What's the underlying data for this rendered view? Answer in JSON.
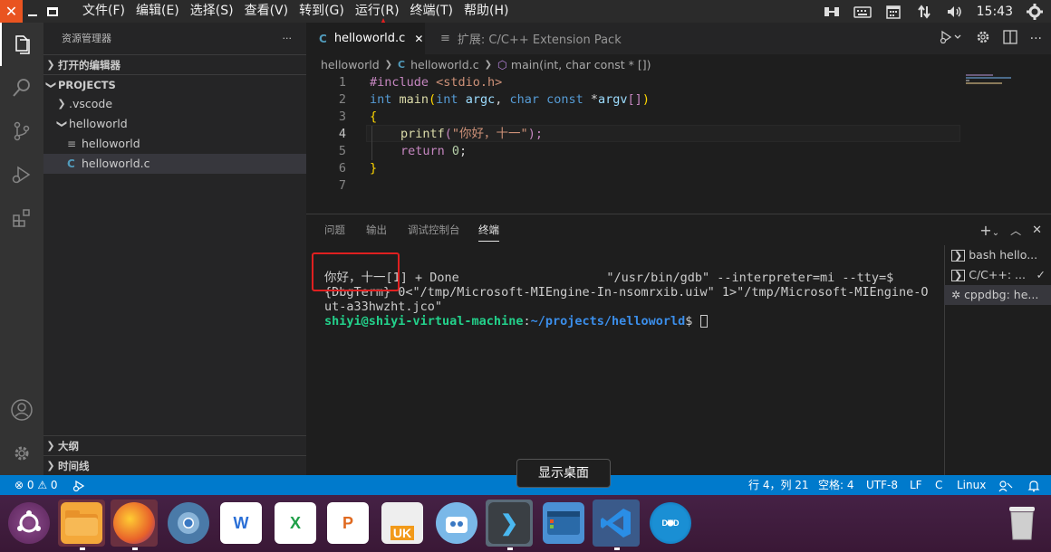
{
  "topbar": {
    "close_symbol": "✕",
    "menus": [
      "文件(F)",
      "编辑(E)",
      "选择(S)",
      "查看(V)",
      "转到(G)",
      "运行(R)",
      "终端(T)",
      "帮助(H)"
    ],
    "time": "15:43",
    "tray_icons": [
      "window-switch-icon",
      "keyboard-icon",
      "calendar-icon",
      "network-icon",
      "volume-icon",
      "power-icon"
    ]
  },
  "activity_icons": [
    "explorer-icon",
    "search-icon",
    "source-control-icon",
    "run-debug-icon",
    "extensions-icon",
    "account-icon",
    "settings-gear-icon"
  ],
  "sidebar": {
    "title": "资源管理器",
    "more": "···",
    "open_editors": "打开的编辑器",
    "projects": "PROJECTS",
    "tree": [
      {
        "label": ".vscode",
        "type": "folder-collapsed"
      },
      {
        "label": "helloworld",
        "type": "folder-open"
      },
      {
        "label": "helloworld",
        "type": "file"
      },
      {
        "label": "helloworld.c",
        "type": "c-file"
      }
    ],
    "outline": "大纲",
    "timeline": "时间线"
  },
  "tabs": [
    {
      "label": "helloworld.c",
      "icon": "C",
      "active": true
    },
    {
      "label": "扩展: C/C++ Extension Pack",
      "icon": "≡",
      "active": false
    }
  ],
  "breadcrumb": {
    "folder": "helloworld",
    "file": "helloworld.c",
    "symbol": "main(int, char const * [])"
  },
  "code": {
    "line_numbers": [
      "1",
      "2",
      "3",
      "4",
      "5",
      "6",
      "7"
    ],
    "l1_pp": "#include",
    "l1_hdr": " <stdio.h>",
    "l2_int": "int",
    "l2_main": " main",
    "l2_paren": "(",
    "l2_int2": "int",
    "l2_argc": " argc",
    "l2_comma": ", ",
    "l2_char": "char",
    "l2_const": " const",
    "l2_star": " *",
    "l2_argv": "argv",
    "l2_brk": "[]",
    "l2_close": ")",
    "l3": "{",
    "l4_fn": "printf",
    "l4_open": "(",
    "l4_str": "\"你好，十一\"",
    "l4_close": ");",
    "l5_ret": "return",
    "l5_num": " 0",
    "l5_semi": ";",
    "l6": "}"
  },
  "panel": {
    "tabs": [
      "问题",
      "输出",
      "调试控制台",
      "终端"
    ],
    "active_tab": "终端",
    "terminal_lines": [
      "你好，十一[1] + Done                    \"/usr/bin/gdb\" --interpreter=mi --tty=$",
      "{DbgTerm} 0<\"/tmp/Microsoft-MIEngine-In-nsomrxib.uiw\" 1>\"/tmp/Microsoft-MIEngine-O",
      "ut-a33hwzht.jco\""
    ],
    "prompt_user": "shiyi@shiyi-virtual-machine",
    "prompt_colon": ":",
    "prompt_path": "~/projects/helloworld",
    "prompt_dollar": "$ ",
    "sessions": [
      "bash hello...",
      "C/C++: ...",
      "cppdbg: he..."
    ]
  },
  "status": {
    "problems": "⊗ 0 ⚠ 0",
    "position": "行 4，列 21",
    "spaces": "空格: 4",
    "encoding": "UTF-8",
    "eol": "LF",
    "language": "C",
    "platform": "Linux"
  },
  "tooltip": "显示桌面",
  "dock": [
    {
      "name": "ubuntu-launcher-icon",
      "glyph": "◎",
      "color": "#6c2a64"
    },
    {
      "name": "files-icon",
      "glyph": "",
      "color": "#f0a030"
    },
    {
      "name": "firefox-icon",
      "glyph": "",
      "color": "#e8622a"
    },
    {
      "name": "chromium-icon",
      "glyph": "",
      "color": "#4a90c8"
    },
    {
      "name": "wps-writer-icon",
      "glyph": "W",
      "color": "#2a6fd6"
    },
    {
      "name": "wps-spreadsheet-icon",
      "glyph": "X",
      "color": "#1f9f48"
    },
    {
      "name": "wps-presentation-icon",
      "glyph": "P",
      "color": "#e06a20"
    },
    {
      "name": "ukylin-icon",
      "glyph": "UK",
      "color": "#e8e8e8"
    },
    {
      "name": "software-center-icon",
      "glyph": "",
      "color": "#5aa0d8"
    },
    {
      "name": "terminal-icon",
      "glyph": "❯",
      "color": "#444a50"
    },
    {
      "name": "show-desktop-icon",
      "glyph": "",
      "color": "#3b8fd4"
    },
    {
      "name": "vscode-icon",
      "glyph": "",
      "color": "#1e6fc2"
    },
    {
      "name": "dvd-icon",
      "glyph": "DVD",
      "color": "#1a8fd4"
    },
    {
      "name": "trash-icon",
      "glyph": "",
      "color": "#d8d8d8"
    }
  ]
}
